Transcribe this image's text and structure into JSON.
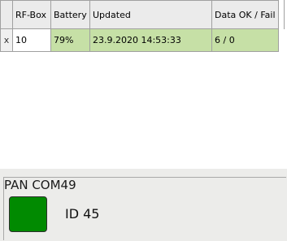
{
  "table": {
    "columns": [
      "RF-Box",
      "Battery",
      "Updated",
      "Data OK / Fail"
    ],
    "rows": [
      {
        "row_header": "x",
        "rf_box": "10",
        "battery": "79%",
        "updated": "23.9.2020 14:53:33",
        "data_ok_fail": "6 / 0"
      }
    ]
  },
  "colors": {
    "row_ok": "#c6e0a6",
    "status_ok": "#018a01"
  },
  "panel": {
    "title": "PAN COM49",
    "id_label": "ID 45"
  }
}
